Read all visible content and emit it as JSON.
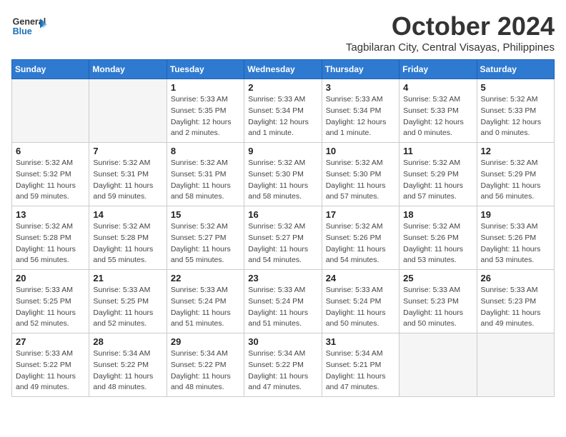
{
  "logo": {
    "line1": "General",
    "line2": "Blue"
  },
  "title": "October 2024",
  "location": "Tagbilaran City, Central Visayas, Philippines",
  "days_of_week": [
    "Sunday",
    "Monday",
    "Tuesday",
    "Wednesday",
    "Thursday",
    "Friday",
    "Saturday"
  ],
  "weeks": [
    [
      {
        "day": "",
        "info": ""
      },
      {
        "day": "",
        "info": ""
      },
      {
        "day": "1",
        "info": "Sunrise: 5:33 AM\nSunset: 5:35 PM\nDaylight: 12 hours\nand 2 minutes."
      },
      {
        "day": "2",
        "info": "Sunrise: 5:33 AM\nSunset: 5:34 PM\nDaylight: 12 hours\nand 1 minute."
      },
      {
        "day": "3",
        "info": "Sunrise: 5:33 AM\nSunset: 5:34 PM\nDaylight: 12 hours\nand 1 minute."
      },
      {
        "day": "4",
        "info": "Sunrise: 5:32 AM\nSunset: 5:33 PM\nDaylight: 12 hours\nand 0 minutes."
      },
      {
        "day": "5",
        "info": "Sunrise: 5:32 AM\nSunset: 5:33 PM\nDaylight: 12 hours\nand 0 minutes."
      }
    ],
    [
      {
        "day": "6",
        "info": "Sunrise: 5:32 AM\nSunset: 5:32 PM\nDaylight: 11 hours\nand 59 minutes."
      },
      {
        "day": "7",
        "info": "Sunrise: 5:32 AM\nSunset: 5:31 PM\nDaylight: 11 hours\nand 59 minutes."
      },
      {
        "day": "8",
        "info": "Sunrise: 5:32 AM\nSunset: 5:31 PM\nDaylight: 11 hours\nand 58 minutes."
      },
      {
        "day": "9",
        "info": "Sunrise: 5:32 AM\nSunset: 5:30 PM\nDaylight: 11 hours\nand 58 minutes."
      },
      {
        "day": "10",
        "info": "Sunrise: 5:32 AM\nSunset: 5:30 PM\nDaylight: 11 hours\nand 57 minutes."
      },
      {
        "day": "11",
        "info": "Sunrise: 5:32 AM\nSunset: 5:29 PM\nDaylight: 11 hours\nand 57 minutes."
      },
      {
        "day": "12",
        "info": "Sunrise: 5:32 AM\nSunset: 5:29 PM\nDaylight: 11 hours\nand 56 minutes."
      }
    ],
    [
      {
        "day": "13",
        "info": "Sunrise: 5:32 AM\nSunset: 5:28 PM\nDaylight: 11 hours\nand 56 minutes."
      },
      {
        "day": "14",
        "info": "Sunrise: 5:32 AM\nSunset: 5:28 PM\nDaylight: 11 hours\nand 55 minutes."
      },
      {
        "day": "15",
        "info": "Sunrise: 5:32 AM\nSunset: 5:27 PM\nDaylight: 11 hours\nand 55 minutes."
      },
      {
        "day": "16",
        "info": "Sunrise: 5:32 AM\nSunset: 5:27 PM\nDaylight: 11 hours\nand 54 minutes."
      },
      {
        "day": "17",
        "info": "Sunrise: 5:32 AM\nSunset: 5:26 PM\nDaylight: 11 hours\nand 54 minutes."
      },
      {
        "day": "18",
        "info": "Sunrise: 5:32 AM\nSunset: 5:26 PM\nDaylight: 11 hours\nand 53 minutes."
      },
      {
        "day": "19",
        "info": "Sunrise: 5:33 AM\nSunset: 5:26 PM\nDaylight: 11 hours\nand 53 minutes."
      }
    ],
    [
      {
        "day": "20",
        "info": "Sunrise: 5:33 AM\nSunset: 5:25 PM\nDaylight: 11 hours\nand 52 minutes."
      },
      {
        "day": "21",
        "info": "Sunrise: 5:33 AM\nSunset: 5:25 PM\nDaylight: 11 hours\nand 52 minutes."
      },
      {
        "day": "22",
        "info": "Sunrise: 5:33 AM\nSunset: 5:24 PM\nDaylight: 11 hours\nand 51 minutes."
      },
      {
        "day": "23",
        "info": "Sunrise: 5:33 AM\nSunset: 5:24 PM\nDaylight: 11 hours\nand 51 minutes."
      },
      {
        "day": "24",
        "info": "Sunrise: 5:33 AM\nSunset: 5:24 PM\nDaylight: 11 hours\nand 50 minutes."
      },
      {
        "day": "25",
        "info": "Sunrise: 5:33 AM\nSunset: 5:23 PM\nDaylight: 11 hours\nand 50 minutes."
      },
      {
        "day": "26",
        "info": "Sunrise: 5:33 AM\nSunset: 5:23 PM\nDaylight: 11 hours\nand 49 minutes."
      }
    ],
    [
      {
        "day": "27",
        "info": "Sunrise: 5:33 AM\nSunset: 5:22 PM\nDaylight: 11 hours\nand 49 minutes."
      },
      {
        "day": "28",
        "info": "Sunrise: 5:34 AM\nSunset: 5:22 PM\nDaylight: 11 hours\nand 48 minutes."
      },
      {
        "day": "29",
        "info": "Sunrise: 5:34 AM\nSunset: 5:22 PM\nDaylight: 11 hours\nand 48 minutes."
      },
      {
        "day": "30",
        "info": "Sunrise: 5:34 AM\nSunset: 5:22 PM\nDaylight: 11 hours\nand 47 minutes."
      },
      {
        "day": "31",
        "info": "Sunrise: 5:34 AM\nSunset: 5:21 PM\nDaylight: 11 hours\nand 47 minutes."
      },
      {
        "day": "",
        "info": ""
      },
      {
        "day": "",
        "info": ""
      }
    ]
  ]
}
